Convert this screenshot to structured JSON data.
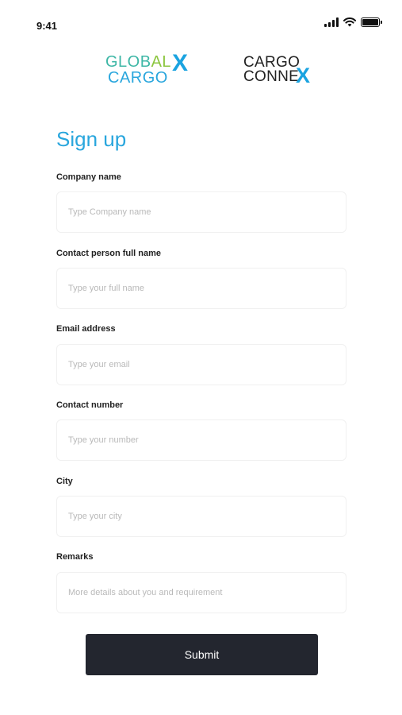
{
  "status_bar": {
    "time": "9:41",
    "icons": [
      "cellular-signal-icon",
      "wifi-icon",
      "battery-icon"
    ]
  },
  "logos": {
    "global_cargo": {
      "line1_a": "GLOB",
      "line1_b": "AL",
      "line2": "CARGO",
      "mark": "X"
    },
    "cargo_connex": {
      "line1": "CARGO",
      "line2": "CONNE",
      "mark": "X"
    }
  },
  "form": {
    "title": "Sign up",
    "fields": [
      {
        "label": "Company name",
        "placeholder": "Type Company name",
        "value": ""
      },
      {
        "label": "Contact person full name",
        "placeholder": "Type your full name",
        "value": ""
      },
      {
        "label": "Email address",
        "placeholder": "Type your email",
        "value": ""
      },
      {
        "label": "Contact number",
        "placeholder": "Type your number",
        "value": ""
      },
      {
        "label": "City",
        "placeholder": "Type your city",
        "value": ""
      },
      {
        "label": "Remarks",
        "placeholder": "More details about you and requirement",
        "value": ""
      }
    ],
    "submit_label": "Submit"
  },
  "colors": {
    "accent": "#29a6dd",
    "logo_teal": "#3eb7a6",
    "logo_green": "#8cc63f",
    "button_bg": "#23262f",
    "placeholder": "#b9b9b9"
  }
}
